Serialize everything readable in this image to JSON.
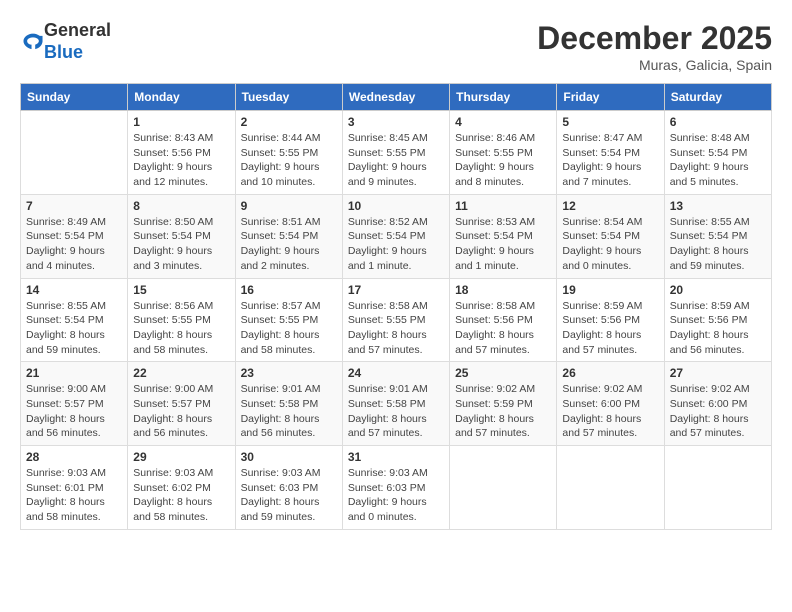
{
  "header": {
    "logo_general": "General",
    "logo_blue": "Blue",
    "month_title": "December 2025",
    "location": "Muras, Galicia, Spain"
  },
  "columns": [
    "Sunday",
    "Monday",
    "Tuesday",
    "Wednesday",
    "Thursday",
    "Friday",
    "Saturday"
  ],
  "weeks": [
    [
      {
        "day": "",
        "info": ""
      },
      {
        "day": "1",
        "info": "Sunrise: 8:43 AM\nSunset: 5:56 PM\nDaylight: 9 hours\nand 12 minutes."
      },
      {
        "day": "2",
        "info": "Sunrise: 8:44 AM\nSunset: 5:55 PM\nDaylight: 9 hours\nand 10 minutes."
      },
      {
        "day": "3",
        "info": "Sunrise: 8:45 AM\nSunset: 5:55 PM\nDaylight: 9 hours\nand 9 minutes."
      },
      {
        "day": "4",
        "info": "Sunrise: 8:46 AM\nSunset: 5:55 PM\nDaylight: 9 hours\nand 8 minutes."
      },
      {
        "day": "5",
        "info": "Sunrise: 8:47 AM\nSunset: 5:54 PM\nDaylight: 9 hours\nand 7 minutes."
      },
      {
        "day": "6",
        "info": "Sunrise: 8:48 AM\nSunset: 5:54 PM\nDaylight: 9 hours\nand 5 minutes."
      }
    ],
    [
      {
        "day": "7",
        "info": "Sunrise: 8:49 AM\nSunset: 5:54 PM\nDaylight: 9 hours\nand 4 minutes."
      },
      {
        "day": "8",
        "info": "Sunrise: 8:50 AM\nSunset: 5:54 PM\nDaylight: 9 hours\nand 3 minutes."
      },
      {
        "day": "9",
        "info": "Sunrise: 8:51 AM\nSunset: 5:54 PM\nDaylight: 9 hours\nand 2 minutes."
      },
      {
        "day": "10",
        "info": "Sunrise: 8:52 AM\nSunset: 5:54 PM\nDaylight: 9 hours\nand 1 minute."
      },
      {
        "day": "11",
        "info": "Sunrise: 8:53 AM\nSunset: 5:54 PM\nDaylight: 9 hours\nand 1 minute."
      },
      {
        "day": "12",
        "info": "Sunrise: 8:54 AM\nSunset: 5:54 PM\nDaylight: 9 hours\nand 0 minutes."
      },
      {
        "day": "13",
        "info": "Sunrise: 8:55 AM\nSunset: 5:54 PM\nDaylight: 8 hours\nand 59 minutes."
      }
    ],
    [
      {
        "day": "14",
        "info": "Sunrise: 8:55 AM\nSunset: 5:54 PM\nDaylight: 8 hours\nand 59 minutes."
      },
      {
        "day": "15",
        "info": "Sunrise: 8:56 AM\nSunset: 5:55 PM\nDaylight: 8 hours\nand 58 minutes."
      },
      {
        "day": "16",
        "info": "Sunrise: 8:57 AM\nSunset: 5:55 PM\nDaylight: 8 hours\nand 58 minutes."
      },
      {
        "day": "17",
        "info": "Sunrise: 8:58 AM\nSunset: 5:55 PM\nDaylight: 8 hours\nand 57 minutes."
      },
      {
        "day": "18",
        "info": "Sunrise: 8:58 AM\nSunset: 5:56 PM\nDaylight: 8 hours\nand 57 minutes."
      },
      {
        "day": "19",
        "info": "Sunrise: 8:59 AM\nSunset: 5:56 PM\nDaylight: 8 hours\nand 57 minutes."
      },
      {
        "day": "20",
        "info": "Sunrise: 8:59 AM\nSunset: 5:56 PM\nDaylight: 8 hours\nand 56 minutes."
      }
    ],
    [
      {
        "day": "21",
        "info": "Sunrise: 9:00 AM\nSunset: 5:57 PM\nDaylight: 8 hours\nand 56 minutes."
      },
      {
        "day": "22",
        "info": "Sunrise: 9:00 AM\nSunset: 5:57 PM\nDaylight: 8 hours\nand 56 minutes."
      },
      {
        "day": "23",
        "info": "Sunrise: 9:01 AM\nSunset: 5:58 PM\nDaylight: 8 hours\nand 56 minutes."
      },
      {
        "day": "24",
        "info": "Sunrise: 9:01 AM\nSunset: 5:58 PM\nDaylight: 8 hours\nand 57 minutes."
      },
      {
        "day": "25",
        "info": "Sunrise: 9:02 AM\nSunset: 5:59 PM\nDaylight: 8 hours\nand 57 minutes."
      },
      {
        "day": "26",
        "info": "Sunrise: 9:02 AM\nSunset: 6:00 PM\nDaylight: 8 hours\nand 57 minutes."
      },
      {
        "day": "27",
        "info": "Sunrise: 9:02 AM\nSunset: 6:00 PM\nDaylight: 8 hours\nand 57 minutes."
      }
    ],
    [
      {
        "day": "28",
        "info": "Sunrise: 9:03 AM\nSunset: 6:01 PM\nDaylight: 8 hours\nand 58 minutes."
      },
      {
        "day": "29",
        "info": "Sunrise: 9:03 AM\nSunset: 6:02 PM\nDaylight: 8 hours\nand 58 minutes."
      },
      {
        "day": "30",
        "info": "Sunrise: 9:03 AM\nSunset: 6:03 PM\nDaylight: 8 hours\nand 59 minutes."
      },
      {
        "day": "31",
        "info": "Sunrise: 9:03 AM\nSunset: 6:03 PM\nDaylight: 9 hours\nand 0 minutes."
      },
      {
        "day": "",
        "info": ""
      },
      {
        "day": "",
        "info": ""
      },
      {
        "day": "",
        "info": ""
      }
    ]
  ]
}
